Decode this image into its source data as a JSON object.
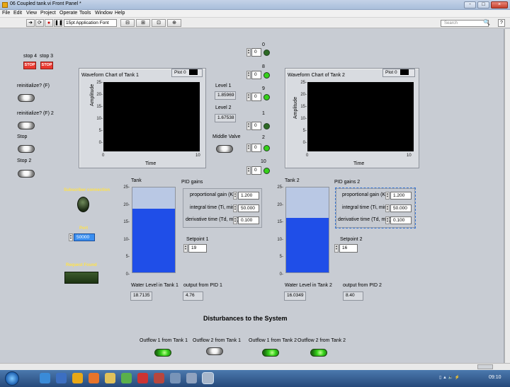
{
  "window": {
    "title": "06 Coupled tank.vi Front Panel *",
    "controls": [
      "-",
      "□",
      "×"
    ]
  },
  "menu": [
    "File",
    "Edit",
    "View",
    "Project",
    "Operate",
    "Tools",
    "Window",
    "Help"
  ],
  "toolbar": {
    "font_select": "15pt Application Font",
    "search_placeholder": "Search",
    "help": "?"
  },
  "left_controls": {
    "stop4_label": "stop 4",
    "stop3_label": "stop 3",
    "stop_btn_text": "STOP",
    "reinit_label": "reinitialize? (F)",
    "reinit2_label": "reinitialize? (F) 2",
    "stop_label": "Stop",
    "stop2_label": "Stop 2",
    "subscriber_label": "Subscriber connection",
    "port_label": "Port",
    "port_value": "50000",
    "request_label": "Request Found"
  },
  "chart1": {
    "title": "Waveform Chart of Tank 1",
    "plot_legend": "Plot 0",
    "ylabel": "Amplitude",
    "xlabel": "Time",
    "yticks": [
      "25-",
      "20-",
      "15-",
      "10-",
      "5-",
      "0-"
    ],
    "xticks": [
      "0",
      "10"
    ]
  },
  "chart2": {
    "title": "Waveform Chart of Tank 2",
    "plot_legend": "Plot 0",
    "ylabel": "Amplitude",
    "xlabel": "Time",
    "yticks": [
      "25-",
      "20-",
      "15-",
      "10-",
      "5-",
      "0-"
    ],
    "xticks": [
      "0",
      "10"
    ]
  },
  "levels": {
    "level1_label": "Level 1",
    "level1_value": "1.85969",
    "level2_label": "Level 2",
    "level2_value": "1.67538",
    "middle_valve_label": "Middle Valve"
  },
  "valve_controls": [
    {
      "label": "0",
      "value": "0",
      "led": "off"
    },
    {
      "label": "8",
      "value": "0",
      "led": "on"
    },
    {
      "label": "9",
      "value": "0",
      "led": "on"
    },
    {
      "label": "1",
      "value": "0",
      "led": "off"
    },
    {
      "label": "2",
      "value": "0",
      "led": "on"
    },
    {
      "label": "10",
      "value": "0",
      "led": "on"
    }
  ],
  "tank1": {
    "label": "Tank",
    "yticks": [
      "25-",
      "20-",
      "15-",
      "10-",
      "5-",
      "0-"
    ],
    "fill_fraction": 0.75,
    "water_level_label": "Water Level in Tank 1",
    "water_level_value": "18.7135",
    "pid_output_label": "output from PID 1",
    "pid_output_value": "4.76",
    "pid_title": "PID gains",
    "kc_label": "proportional gain (Kc)",
    "kc_value": "1.200",
    "ti_label": "integral time (Ti, min)",
    "ti_value": "50.000",
    "td_label": "derivative time (Td, min)",
    "td_value": "0.100",
    "setpoint_label": "Setpoint 1",
    "setpoint_value": "19"
  },
  "tank2": {
    "label": "Tank 2",
    "yticks": [
      "25-",
      "20-",
      "15-",
      "10-",
      "5-",
      "0-"
    ],
    "fill_fraction": 0.64,
    "water_level_label": "Water Level in Tank 2",
    "water_level_value": "16.0349",
    "pid_output_label": "output from PID 2",
    "pid_output_value": "8.40",
    "pid_title": "PID gains 2",
    "kc_label": "proportional gain (Kc)",
    "kc_value": "1.200",
    "ti_label": "integral time (Ti, min)",
    "ti_value": "50.000",
    "td_label": "derivative time (Td, min)",
    "td_value": "0.100",
    "setpoint_label": "Setpoint 2",
    "setpoint_value": "16"
  },
  "disturbances": {
    "title": "Disturbances to the System",
    "items": [
      "Outflow 1 from Tank 1",
      "Outflow 2 from Tank 1",
      "Outflow 1 from Tank 2",
      "Outflow 2 from Tank 2"
    ]
  },
  "taskbar": {
    "time": "09:10"
  },
  "colors": {
    "water": "#1f4ee8",
    "water_light": "#b9c8e4",
    "stop": "#e9382f",
    "led_on": "#35d11a",
    "led_off": "#2d6a25"
  }
}
